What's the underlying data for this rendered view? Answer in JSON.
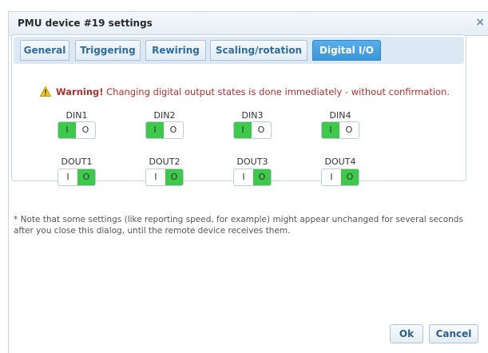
{
  "dialog": {
    "title": "PMU device #19 settings",
    "close_icon": "×"
  },
  "tabs": [
    {
      "label": "General",
      "active": false
    },
    {
      "label": "Triggering",
      "active": false
    },
    {
      "label": "Rewiring",
      "active": false
    },
    {
      "label": "Scaling/rotation",
      "active": false
    },
    {
      "label": "Digital I/O",
      "active": true
    }
  ],
  "warning": {
    "icon": "warning-triangle-icon",
    "prefix": "Warning!",
    "text": " Changing digital output states is done immediately - without confirmation."
  },
  "din": [
    {
      "label": "DIN1",
      "i": "I",
      "o": "O",
      "state": "I"
    },
    {
      "label": "DIN2",
      "i": "I",
      "o": "O",
      "state": "I"
    },
    {
      "label": "DIN3",
      "i": "I",
      "o": "O",
      "state": "I"
    },
    {
      "label": "DIN4",
      "i": "I",
      "o": "O",
      "state": "I"
    }
  ],
  "dout": [
    {
      "label": "DOUT1",
      "i": "I",
      "o": "O",
      "state": "O"
    },
    {
      "label": "DOUT2",
      "i": "I",
      "o": "O",
      "state": "O"
    },
    {
      "label": "DOUT3",
      "i": "I",
      "o": "O",
      "state": "O"
    },
    {
      "label": "DOUT4",
      "i": "I",
      "o": "O",
      "state": "O"
    }
  ],
  "note": "* Note that some settings (like reporting speed, for example) might appear unchanged for several seconds after you close this dialog, until the remote device receives them.",
  "buttons": {
    "ok": "Ok",
    "cancel": "Cancel"
  },
  "colors": {
    "active_tab": "#3a95da",
    "switch_on": "#3fc94a",
    "warning_text": "#b03030"
  }
}
